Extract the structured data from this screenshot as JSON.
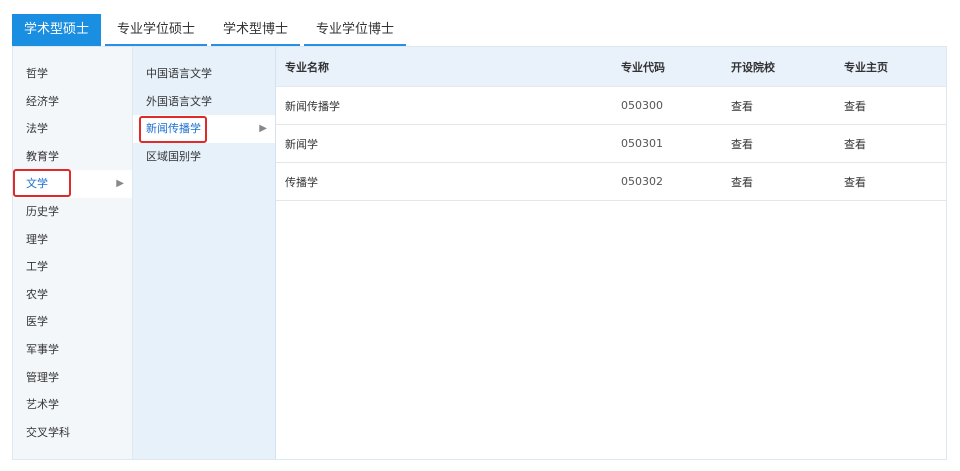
{
  "tabs": [
    {
      "label": "学术型硕士",
      "active": true
    },
    {
      "label": "专业学位硕士",
      "active": false
    },
    {
      "label": "学术型博士",
      "active": false
    },
    {
      "label": "专业学位博士",
      "active": false
    }
  ],
  "categories": [
    {
      "label": "哲学"
    },
    {
      "label": "经济学"
    },
    {
      "label": "法学"
    },
    {
      "label": "教育学"
    },
    {
      "label": "文学",
      "selected": true
    },
    {
      "label": "历史学"
    },
    {
      "label": "理学"
    },
    {
      "label": "工学"
    },
    {
      "label": "农学"
    },
    {
      "label": "医学"
    },
    {
      "label": "军事学"
    },
    {
      "label": "管理学"
    },
    {
      "label": "艺术学"
    },
    {
      "label": "交叉学科"
    }
  ],
  "subcategories": [
    {
      "label": "中国语言文学"
    },
    {
      "label": "外国语言文学"
    },
    {
      "label": "新闻传播学",
      "selected": true
    },
    {
      "label": "区域国别学"
    }
  ],
  "table": {
    "headers": {
      "name": "专业名称",
      "code": "专业代码",
      "school": "开设院校",
      "home": "专业主页"
    },
    "rows": [
      {
        "name": "新闻传播学",
        "code": "050300",
        "school": "查看",
        "home": "查看"
      },
      {
        "name": "新闻学",
        "code": "050301",
        "school": "查看",
        "home": "查看"
      },
      {
        "name": "传播学",
        "code": "050302",
        "school": "查看",
        "home": "查看"
      }
    ]
  },
  "icons": {
    "expand": "chevron-right-icon"
  },
  "colors": {
    "accent": "#1a8ee0",
    "highlight": "#e02a2a",
    "selected_text": "#1a6fcf"
  }
}
